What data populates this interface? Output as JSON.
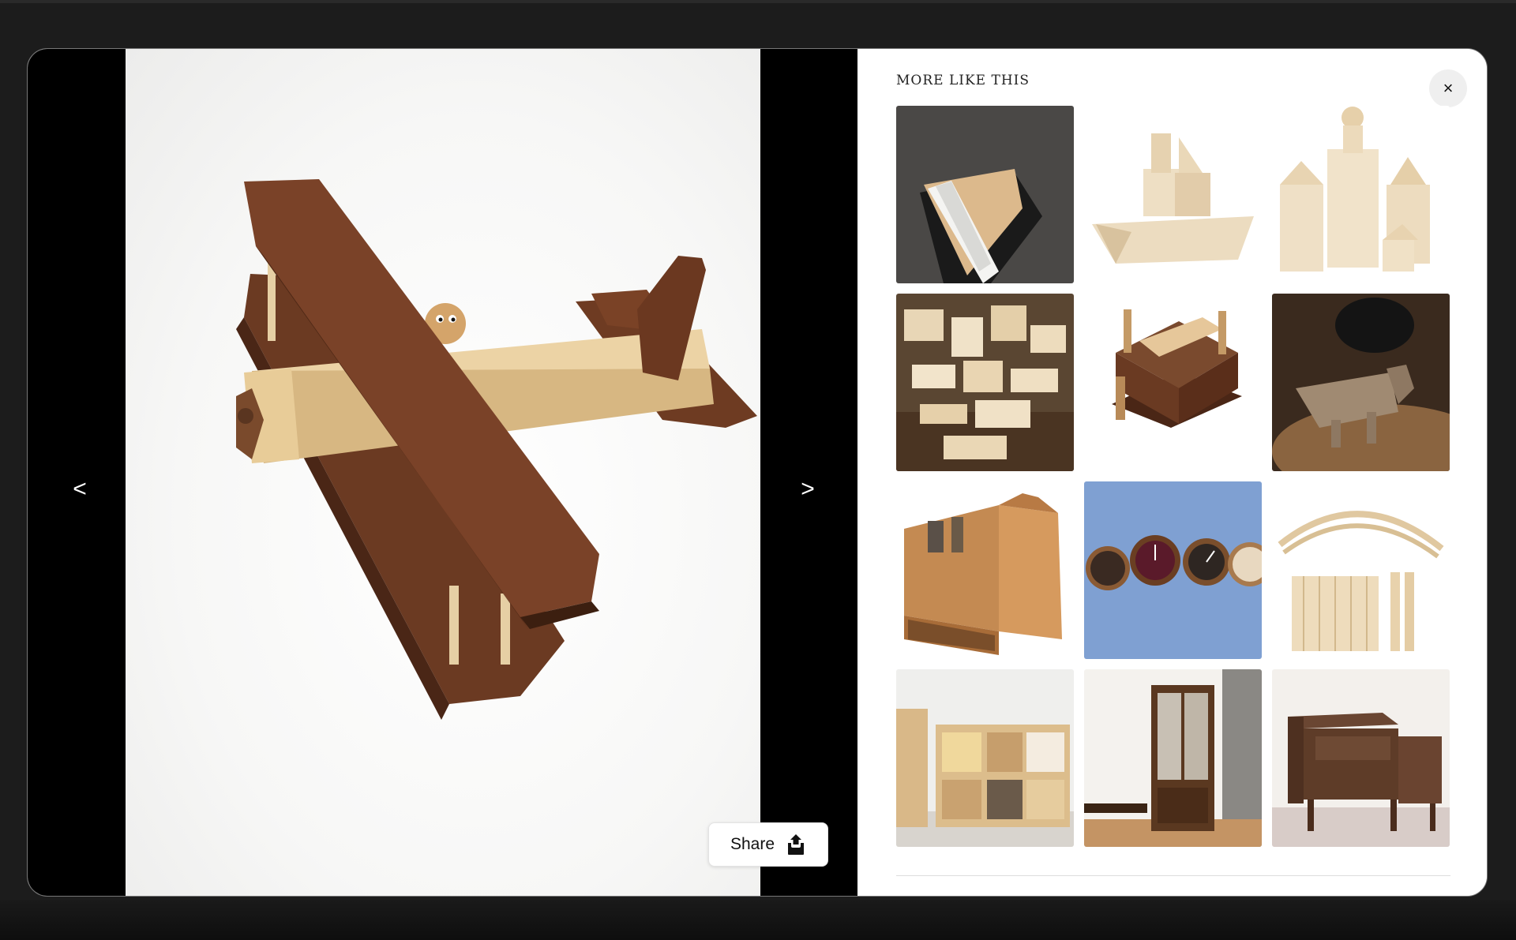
{
  "viewer": {
    "prev_label": "<",
    "next_label": ">",
    "share_label": "Share",
    "share_icon": "share-upload-icon",
    "photo_subject": "wooden-biplane-toy"
  },
  "panel": {
    "title": "MORE LIKE THIS",
    "close_label": "×",
    "close_icon": "close-icon",
    "tiles": [
      {
        "name": "wooden-rocket-puzzle"
      },
      {
        "name": "wooden-boat-blocks"
      },
      {
        "name": "wooden-castle-blocks"
      },
      {
        "name": "wooden-block-set"
      },
      {
        "name": "wooden-coaster-set"
      },
      {
        "name": "wooden-dinosaur-lamp"
      },
      {
        "name": "wooden-toolbox"
      },
      {
        "name": "wooden-clocks"
      },
      {
        "name": "wooden-stick-bridge"
      },
      {
        "name": "wooden-storage-shelves"
      },
      {
        "name": "wooden-curio-cabinet"
      },
      {
        "name": "walnut-nightstand"
      }
    ]
  },
  "colors": {
    "backdrop": "#1c1c1c",
    "viewer_bg": "#000000",
    "panel_bg": "#ffffff",
    "close_bg": "#efefef"
  }
}
